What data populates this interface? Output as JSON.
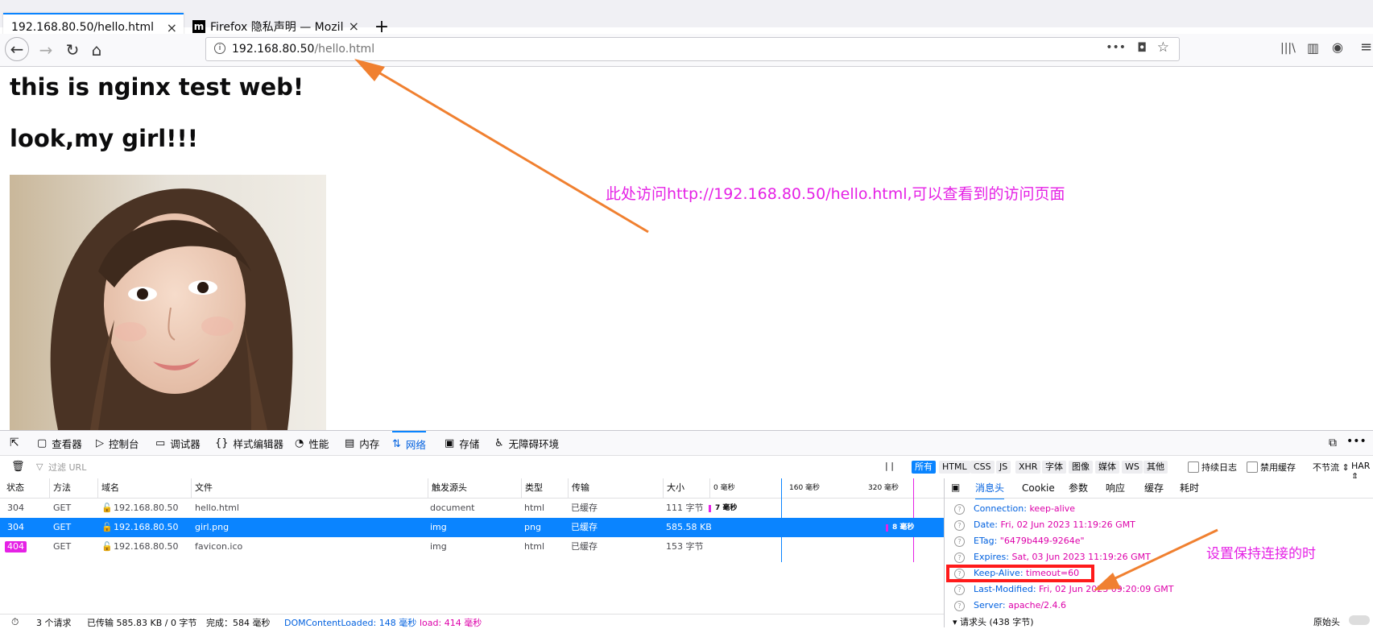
{
  "tabs": [
    {
      "title": "192.168.80.50/hello.html",
      "close": "×"
    },
    {
      "title": "Firefox 隐私声明 — Mozil",
      "close": "×",
      "favicon": "m"
    }
  ],
  "new_tab": "+",
  "nav": {
    "back": "←",
    "forward": "→",
    "reload": "↻",
    "home": "⌂",
    "url_host": "192.168.80.50",
    "url_path": "/hello.html",
    "page_actions": "•••",
    "pocket": "◘",
    "star": "☆",
    "library": "|||\\",
    "sidebar": "▥",
    "account": "◉",
    "menu": "≡"
  },
  "page": {
    "h1": "this is nginx test web!",
    "h2": "look,my girl!!!"
  },
  "annotations": {
    "top": "此处访问http://192.168.80.50/hello.html,可以查看到的访问页面",
    "right": "设置保持连接的时"
  },
  "devtools": {
    "tabs": [
      "查看器",
      "控制台",
      "调试器",
      "样式编辑器",
      "性能",
      "内存",
      "网络",
      "存储",
      "无障碍环境"
    ],
    "filter_placeholder": "过滤 URL",
    "pause": "| |",
    "filter_buttons": [
      "所有",
      "HTML",
      "CSS",
      "JS",
      "XHR",
      "字体",
      "图像",
      "媒体",
      "WS",
      "其他"
    ],
    "persist_log": "持续日志",
    "disable_cache": "禁用缓存",
    "throttle": "不节流 ⇕",
    "har": "HAR ⇕",
    "columns": [
      "状态",
      "方法",
      "域名",
      "文件",
      "触发源头",
      "类型",
      "传输",
      "大小"
    ],
    "timeline_ticks": [
      "0 毫秒",
      "160 毫秒",
      "320 毫秒"
    ],
    "rows": [
      {
        "status": "304",
        "method": "GET",
        "domain": "192.168.80.50",
        "file": "hello.html",
        "cause": "document",
        "type": "html",
        "transfer": "已缓存",
        "size": "111 字节",
        "timing": "7 毫秒"
      },
      {
        "status": "304",
        "method": "GET",
        "domain": "192.168.80.50",
        "file": "girl.png",
        "cause": "img",
        "type": "png",
        "transfer": "已缓存",
        "size": "585.58 KB",
        "timing": "8 毫秒"
      },
      {
        "status": "404",
        "method": "GET",
        "domain": "192.168.80.50",
        "file": "favicon.ico",
        "cause": "img",
        "type": "html",
        "transfer": "已缓存",
        "size": "153 字节",
        "timing": ""
      }
    ],
    "side_tabs": [
      "消息头",
      "Cookie",
      "参数",
      "响应",
      "缓存",
      "耗时"
    ],
    "headers": [
      {
        "name": "Connection:",
        "value": "keep-alive"
      },
      {
        "name": "Date:",
        "value": "Fri, 02 Jun 2023 11:19:26 GMT"
      },
      {
        "name": "ETag:",
        "value": "\"6479b449-9264e\""
      },
      {
        "name": "Expires:",
        "value": "Sat, 03 Jun 2023 11:19:26 GMT"
      },
      {
        "name": "Keep-Alive:",
        "value": "timeout=60"
      },
      {
        "name": "Last-Modified:",
        "value": "Fri, 02 Jun 2023 09:20:09 GMT"
      },
      {
        "name": "Server:",
        "value": "apache/2.4.6"
      }
    ],
    "request_headers": "▾ 请求头 (438 字节)",
    "raw_headers": "原始头",
    "status": {
      "requests": "3 个请求",
      "transferred": "已传输 585.83 KB / 0 字节",
      "finish": "完成：584 毫秒",
      "dcl": "DOMContentLoaded: 148 毫秒",
      "load": "load: 414 毫秒"
    }
  }
}
